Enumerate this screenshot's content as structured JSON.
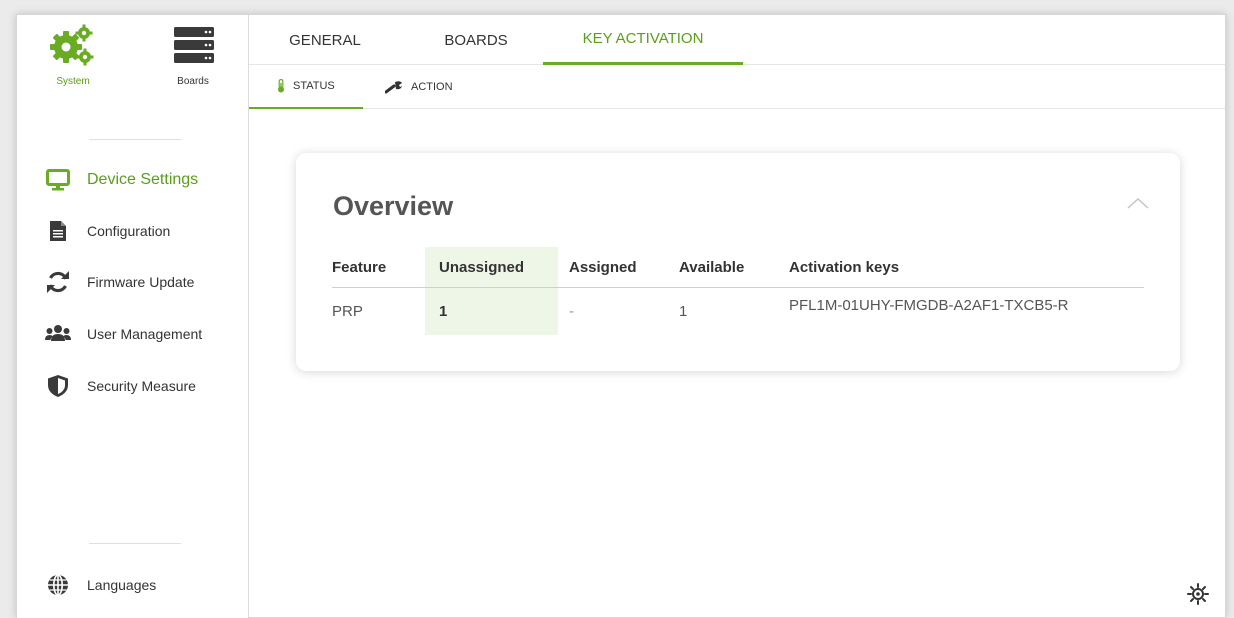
{
  "sidebar": {
    "top_icons": [
      {
        "label": "System"
      },
      {
        "label": "Boards"
      }
    ],
    "items": [
      {
        "label": "Device Settings"
      },
      {
        "label": "Configuration"
      },
      {
        "label": "Firmware Update"
      },
      {
        "label": "User Management"
      },
      {
        "label": "Security Measure"
      }
    ],
    "languages": "Languages"
  },
  "tabs": [
    {
      "label": "GENERAL"
    },
    {
      "label": "BOARDS"
    },
    {
      "label": "KEY ACTIVATION"
    }
  ],
  "subtabs": [
    {
      "label": "STATUS"
    },
    {
      "label": "ACTION"
    }
  ],
  "overview": {
    "title": "Overview",
    "columns": [
      "Feature",
      "Unassigned",
      "Assigned",
      "Available",
      "Activation keys"
    ],
    "rows": [
      [
        "PRP",
        "1",
        "-",
        "1",
        "PFL1M-01UHY-FMGDB-A2AF1-TXCB5-R"
      ]
    ]
  },
  "colors": {
    "accent": "#6aab24",
    "accent_text": "#5a9e1a",
    "highlight_column": "#eef6e8"
  }
}
